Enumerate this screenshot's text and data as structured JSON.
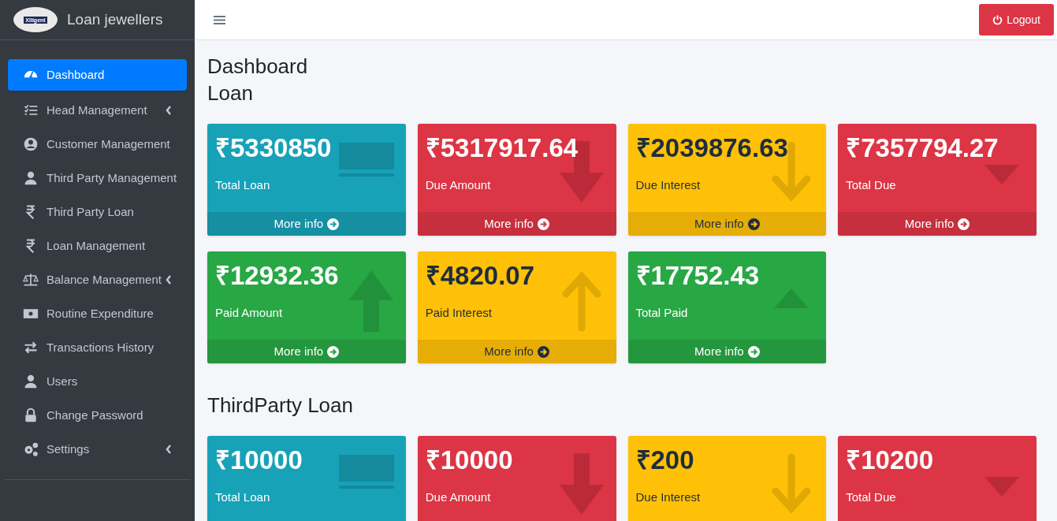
{
  "brand": {
    "logo_text": "Xlligent",
    "name": "Loan jewellers"
  },
  "sidebar": {
    "items": [
      {
        "label": "Dashboard",
        "kind": "gauge",
        "selected": true,
        "expandable": false
      },
      {
        "label": "Head Management",
        "kind": "list",
        "selected": false,
        "expandable": true
      },
      {
        "label": "Customer Management",
        "kind": "user-circle",
        "selected": false,
        "expandable": false
      },
      {
        "label": "Third Party Management",
        "kind": "user",
        "selected": false,
        "expandable": false
      },
      {
        "label": "Third Party Loan",
        "kind": "rupee",
        "selected": false,
        "expandable": false
      },
      {
        "label": "Loan Management",
        "kind": "rupee",
        "selected": false,
        "expandable": false
      },
      {
        "label": "Balance Management",
        "kind": "scale",
        "selected": false,
        "expandable": true
      },
      {
        "label": "Routine Expenditure",
        "kind": "money",
        "selected": false,
        "expandable": false
      },
      {
        "label": "Transactions History",
        "kind": "exchange",
        "selected": false,
        "expandable": false
      },
      {
        "label": "Users",
        "kind": "user",
        "selected": false,
        "expandable": false
      },
      {
        "label": "Change Password",
        "kind": "lock",
        "selected": false,
        "expandable": false
      },
      {
        "label": "Settings",
        "kind": "gears",
        "selected": false,
        "expandable": true
      }
    ]
  },
  "topbar": {
    "logout": "Logout"
  },
  "page_title": "Dashboard",
  "sections": [
    {
      "title": "Loan",
      "cards": [
        {
          "amount": "₹5330850",
          "label": "Total Loan",
          "kind": "loan",
          "footer": "More info"
        },
        {
          "amount": "₹5317917.64",
          "label": "Due Amount",
          "kind": "due",
          "footer": "More info"
        },
        {
          "amount": "₹2039876.63",
          "label": "Due Interest",
          "kind": "due-interest",
          "footer": "More info"
        },
        {
          "amount": "₹7357794.27",
          "label": "Total Due",
          "kind": "total-due",
          "footer": "More info"
        },
        {
          "amount": "₹12932.36",
          "label": "Paid Amount",
          "kind": "paid",
          "footer": "More info"
        },
        {
          "amount": "₹4820.07",
          "label": "Paid Interest",
          "kind": "paid-interest",
          "footer": "More info"
        },
        {
          "amount": "₹17752.43",
          "label": "Total Paid",
          "kind": "total-paid",
          "footer": "More info"
        }
      ]
    },
    {
      "title": "ThirdParty Loan",
      "cards": [
        {
          "amount": "₹10000",
          "label": "Total Loan",
          "kind": "loan"
        },
        {
          "amount": "₹10000",
          "label": "Due Amount",
          "kind": "due"
        },
        {
          "amount": "₹200",
          "label": "Due Interest",
          "kind": "due-interest"
        },
        {
          "amount": "₹10200",
          "label": "Total Due",
          "kind": "total-due"
        }
      ]
    }
  ]
}
